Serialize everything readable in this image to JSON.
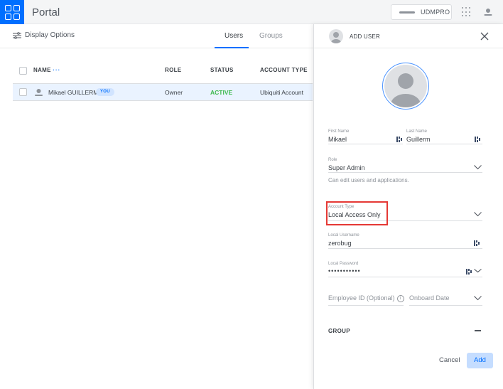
{
  "header": {
    "title": "Portal",
    "device_label": "UDMPRO",
    "brand_color": "#006fff"
  },
  "toolbar": {
    "display_options": "Display Options",
    "tabs": [
      {
        "label": "Users",
        "active": true
      },
      {
        "label": "Groups",
        "active": false
      }
    ]
  },
  "table": {
    "columns": [
      "NAME",
      "ROLE",
      "STATUS",
      "ACCOUNT TYPE"
    ],
    "name_menu": "···",
    "rows": [
      {
        "name": "Mikael GUILLERM",
        "badge": "YOU",
        "role": "Owner",
        "status": "ACTIVE",
        "account_type": "Ubiquiti Account"
      }
    ]
  },
  "panel": {
    "title": "ADD USER",
    "first_name": {
      "label": "First Name",
      "value": "Mikael"
    },
    "last_name": {
      "label": "Last Name",
      "value": "Guillerm"
    },
    "role": {
      "label": "Role",
      "value": "Super Admin",
      "hint": "Can edit users and applications."
    },
    "account_type": {
      "label": "Account Type",
      "value": "Local Access Only"
    },
    "local_username": {
      "label": "Local Username",
      "value": "zerobug"
    },
    "local_password": {
      "label": "Local Password",
      "value": "•••••••••••"
    },
    "employee_id": {
      "placeholder": "Employee ID (Optional)",
      "info": "i"
    },
    "onboard_date": {
      "placeholder": "Onboard Date"
    },
    "group": {
      "label": "GROUP",
      "toggle": "−"
    },
    "cancel_label": "Cancel",
    "add_label": "Add"
  }
}
